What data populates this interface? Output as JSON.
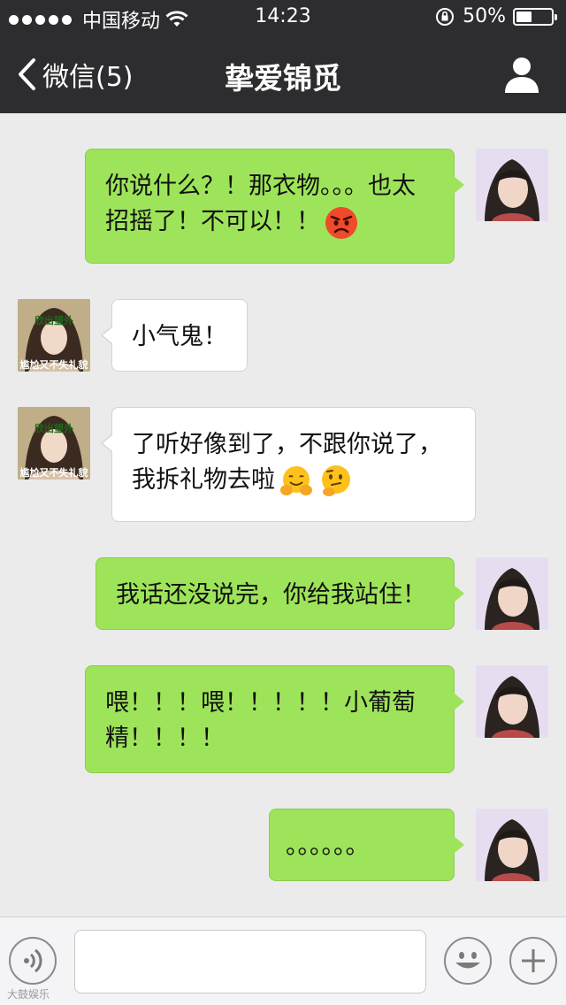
{
  "status_bar": {
    "carrier": "中国移动",
    "time": "14:23",
    "battery_percent_label": "50%",
    "battery_level": 0.5
  },
  "nav": {
    "back_label": "微信(5)",
    "title": "挚爱锦觅"
  },
  "messages": [
    {
      "sender": "me",
      "text": "你说什么？！那衣物。。。也太招摇了！不可以！！",
      "emojis": [
        "angry-face-emoji"
      ]
    },
    {
      "sender": "them",
      "text": "小气鬼！",
      "avatar_caption_top": "欣出望外",
      "avatar_caption_bottom": "尴尬又不失礼貌"
    },
    {
      "sender": "them",
      "text": "了听好像到了，不跟你说了，我拆礼物去啦",
      "emojis": [
        "hugging-face-emoji",
        "thinking-face-emoji"
      ],
      "avatar_caption_top": "欣出望外",
      "avatar_caption_bottom": "尴尬又不失礼貌"
    },
    {
      "sender": "me",
      "text": "我话还没说完，你给我站住！"
    },
    {
      "sender": "me",
      "text": "喂！！！喂！！！！！小葡萄精！！！！"
    },
    {
      "sender": "me",
      "text": "。。。。。。"
    }
  ],
  "footer": {
    "watermark": "大鼓娱乐"
  },
  "colors": {
    "header_bg": "#2d2d30",
    "chat_bg": "#ebebeb",
    "my_bubble": "#9ee45a",
    "their_bubble": "#ffffff"
  }
}
